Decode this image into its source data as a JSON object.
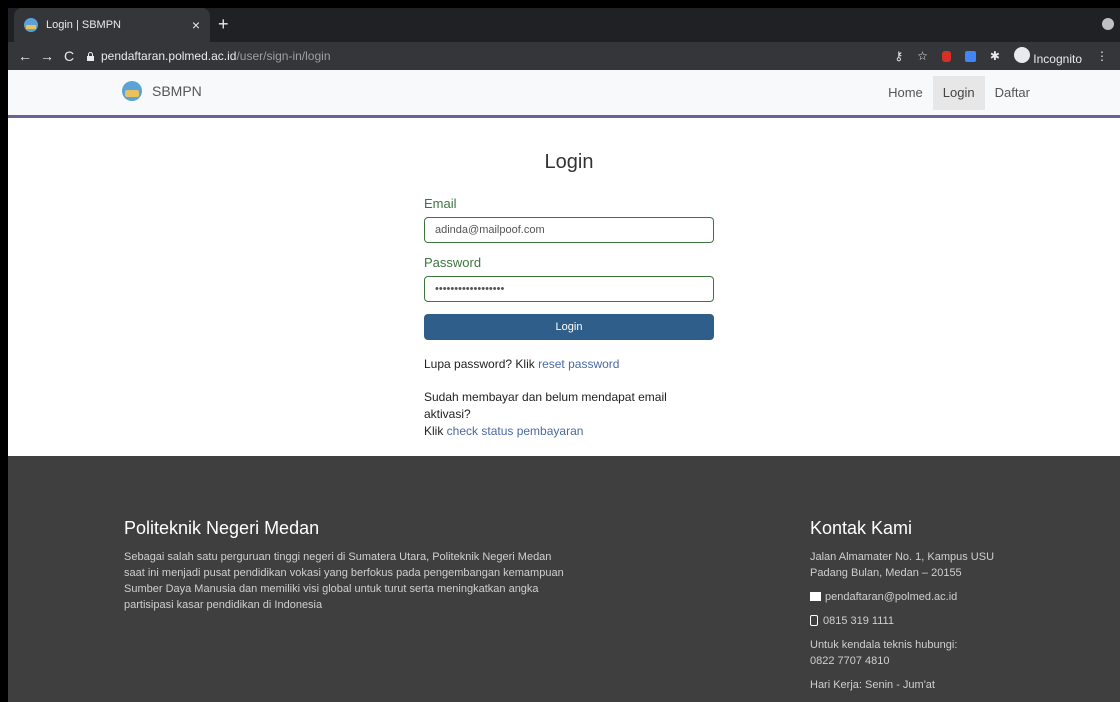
{
  "browser": {
    "tab_title": "Login | SBMPN",
    "url_host": "pendaftaran.polmed.ac.id",
    "url_path": "/user/sign-in/login",
    "profile_label": "Incognito"
  },
  "site": {
    "brand": "SBMPN",
    "nav": [
      "Home",
      "Login",
      "Daftar"
    ]
  },
  "login": {
    "title": "Login",
    "email_label": "Email",
    "email_value": "adinda@mailpoof.com",
    "password_label": "Password",
    "password_value": "••••••••••••••••••",
    "button": "Login",
    "forgot_prefix": "Lupa password? Klik ",
    "forgot_link": "reset password",
    "paid_text": "Sudah membayar dan belum mendapat email aktivasi?",
    "paid_prefix": "Klik ",
    "paid_link": "check status pembayaran"
  },
  "footer": {
    "left_title": "Politeknik Negeri Medan",
    "left_desc": "Sebagai salah satu perguruan tinggi negeri di Sumatera Utara, Politeknik Negeri Medan saat ini menjadi pusat pendidikan vokasi yang berfokus pada pengembangan kemampuan Sumber Daya Manusia dan memiliki visi global untuk turut serta meningkatkan angka partisipasi kasar pendidikan di Indonesia",
    "right_title": "Kontak Kami",
    "address1": "Jalan Almamater No. 1, Kampus USU",
    "address2": "Padang Bulan, Medan – 20155",
    "email": "pendaftaran@polmed.ac.id",
    "phone": "0815 319 1111",
    "tech_label": "Untuk kendala teknis hubungi:",
    "tech_phone": "0822 7707 4810",
    "hours": "Hari Kerja: Senin - Jum'at"
  },
  "colors": {
    "nav_border": "#6f6198",
    "button": "#2f5e8b",
    "label_green": "#3c763d",
    "footer_bg": "#3f3f3f"
  }
}
